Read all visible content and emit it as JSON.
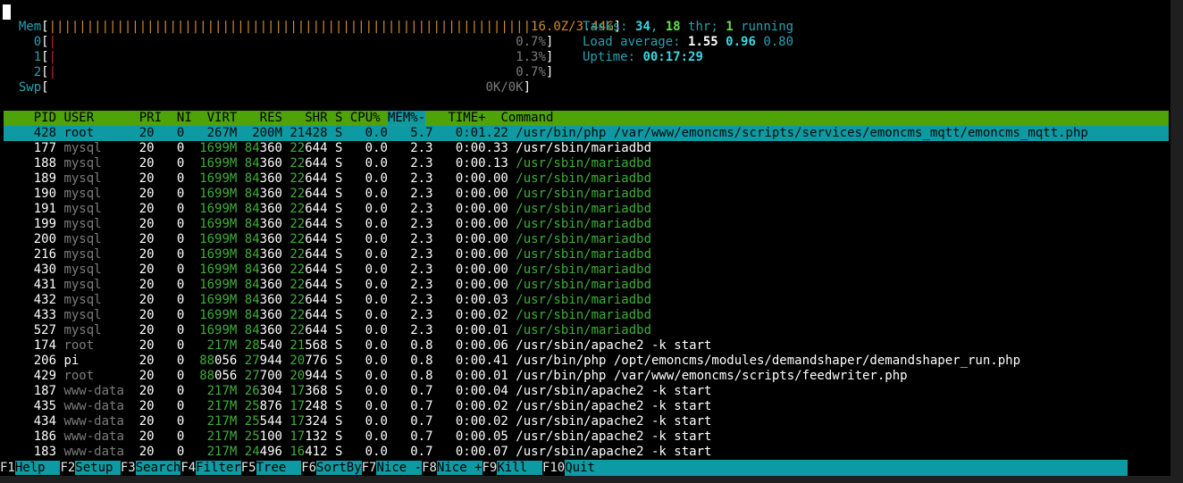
{
  "meters": {
    "mem": {
      "label": "Mem",
      "bar": "||||||||||||||||||||||||||||||||||||||||||||||||||||||||||||||||",
      "value": "16.0Z/3.44G"
    },
    "cpu": [
      {
        "label": "0",
        "value": "0.7%"
      },
      {
        "label": "1",
        "value": "1.3%"
      },
      {
        "label": "2",
        "value": "0.7%"
      }
    ],
    "swp": {
      "label": "Swp",
      "value": "0K/0K"
    }
  },
  "summary": {
    "tasks_label": "Tasks:",
    "tasks": "34",
    "thr": "18",
    "thr_label": "thr;",
    "running": "1",
    "running_label": "running",
    "load_label": "Load average:",
    "load1": "1.55",
    "load5": "0.96",
    "load15": "0.80",
    "uptime_label": "Uptime:",
    "uptime": "00:17:29"
  },
  "header": {
    "pid": "PID",
    "user": "USER",
    "pri": "PRI",
    "ni": "NI",
    "virt": "VIRT",
    "res": "RES",
    "shr": "SHR",
    "s": "S",
    "cpu": "CPU%",
    "mem": "MEM%-",
    "time": "TIME+",
    "command": "Command"
  },
  "rows": [
    {
      "pid": "428",
      "user": "root",
      "pri": "20",
      "ni": "0",
      "virt": "267M",
      "res": "200M",
      "shr": "21428",
      "s": "S",
      "cpu": "0.0",
      "mem": "5.7",
      "time": "0:01.22",
      "cmd": "/usr/bin/php /var/www/emoncms/scripts/services/emoncms_mqtt/emoncms_mqtt.php",
      "selected": true
    },
    {
      "pid": "177",
      "user": "mysql",
      "pri": "20",
      "ni": "0",
      "virt": "1699M",
      "res": "84360",
      "shr": "22644",
      "s": "S",
      "cpu": "0.0",
      "mem": "2.3",
      "time": "0:00.33",
      "cmd": "/usr/sbin/mariadbd"
    },
    {
      "pid": "188",
      "user": "mysql",
      "pri": "20",
      "ni": "0",
      "virt": "1699M",
      "res": "84360",
      "shr": "22644",
      "s": "S",
      "cpu": "0.0",
      "mem": "2.3",
      "time": "0:00.13",
      "cmd": "/usr/sbin/mariadbd",
      "thread": true
    },
    {
      "pid": "189",
      "user": "mysql",
      "pri": "20",
      "ni": "0",
      "virt": "1699M",
      "res": "84360",
      "shr": "22644",
      "s": "S",
      "cpu": "0.0",
      "mem": "2.3",
      "time": "0:00.00",
      "cmd": "/usr/sbin/mariadbd",
      "thread": true
    },
    {
      "pid": "190",
      "user": "mysql",
      "pri": "20",
      "ni": "0",
      "virt": "1699M",
      "res": "84360",
      "shr": "22644",
      "s": "S",
      "cpu": "0.0",
      "mem": "2.3",
      "time": "0:00.00",
      "cmd": "/usr/sbin/mariadbd",
      "thread": true
    },
    {
      "pid": "191",
      "user": "mysql",
      "pri": "20",
      "ni": "0",
      "virt": "1699M",
      "res": "84360",
      "shr": "22644",
      "s": "S",
      "cpu": "0.0",
      "mem": "2.3",
      "time": "0:00.00",
      "cmd": "/usr/sbin/mariadbd",
      "thread": true
    },
    {
      "pid": "199",
      "user": "mysql",
      "pri": "20",
      "ni": "0",
      "virt": "1699M",
      "res": "84360",
      "shr": "22644",
      "s": "S",
      "cpu": "0.0",
      "mem": "2.3",
      "time": "0:00.00",
      "cmd": "/usr/sbin/mariadbd",
      "thread": true
    },
    {
      "pid": "200",
      "user": "mysql",
      "pri": "20",
      "ni": "0",
      "virt": "1699M",
      "res": "84360",
      "shr": "22644",
      "s": "S",
      "cpu": "0.0",
      "mem": "2.3",
      "time": "0:00.00",
      "cmd": "/usr/sbin/mariadbd",
      "thread": true
    },
    {
      "pid": "216",
      "user": "mysql",
      "pri": "20",
      "ni": "0",
      "virt": "1699M",
      "res": "84360",
      "shr": "22644",
      "s": "S",
      "cpu": "0.0",
      "mem": "2.3",
      "time": "0:00.00",
      "cmd": "/usr/sbin/mariadbd",
      "thread": true
    },
    {
      "pid": "430",
      "user": "mysql",
      "pri": "20",
      "ni": "0",
      "virt": "1699M",
      "res": "84360",
      "shr": "22644",
      "s": "S",
      "cpu": "0.0",
      "mem": "2.3",
      "time": "0:00.00",
      "cmd": "/usr/sbin/mariadbd",
      "thread": true
    },
    {
      "pid": "431",
      "user": "mysql",
      "pri": "20",
      "ni": "0",
      "virt": "1699M",
      "res": "84360",
      "shr": "22644",
      "s": "S",
      "cpu": "0.0",
      "mem": "2.3",
      "time": "0:00.00",
      "cmd": "/usr/sbin/mariadbd",
      "thread": true
    },
    {
      "pid": "432",
      "user": "mysql",
      "pri": "20",
      "ni": "0",
      "virt": "1699M",
      "res": "84360",
      "shr": "22644",
      "s": "S",
      "cpu": "0.0",
      "mem": "2.3",
      "time": "0:00.03",
      "cmd": "/usr/sbin/mariadbd",
      "thread": true
    },
    {
      "pid": "433",
      "user": "mysql",
      "pri": "20",
      "ni": "0",
      "virt": "1699M",
      "res": "84360",
      "shr": "22644",
      "s": "S",
      "cpu": "0.0",
      "mem": "2.3",
      "time": "0:00.02",
      "cmd": "/usr/sbin/mariadbd",
      "thread": true
    },
    {
      "pid": "527",
      "user": "mysql",
      "pri": "20",
      "ni": "0",
      "virt": "1699M",
      "res": "84360",
      "shr": "22644",
      "s": "S",
      "cpu": "0.0",
      "mem": "2.3",
      "time": "0:00.01",
      "cmd": "/usr/sbin/mariadbd",
      "thread": true
    },
    {
      "pid": "174",
      "user": "root",
      "pri": "20",
      "ni": "0",
      "virt": "217M",
      "res": "28540",
      "shr": "21568",
      "s": "S",
      "cpu": "0.0",
      "mem": "0.8",
      "time": "0:00.06",
      "cmd": "/usr/sbin/apache2 -k start"
    },
    {
      "pid": "206",
      "user": "pi",
      "pri": "20",
      "ni": "0",
      "virt": "88056",
      "res": "27944",
      "shr": "20776",
      "s": "S",
      "cpu": "0.0",
      "mem": "0.8",
      "time": "0:00.41",
      "cmd": "/usr/bin/php /opt/emoncms/modules/demandshaper/demandshaper_run.php",
      "user_bright": true
    },
    {
      "pid": "429",
      "user": "root",
      "pri": "20",
      "ni": "0",
      "virt": "88056",
      "res": "27700",
      "shr": "20944",
      "s": "S",
      "cpu": "0.0",
      "mem": "0.8",
      "time": "0:00.01",
      "cmd": "/usr/bin/php /var/www/emoncms/scripts/feedwriter.php"
    },
    {
      "pid": "187",
      "user": "www-data",
      "pri": "20",
      "ni": "0",
      "virt": "217M",
      "res": "26304",
      "shr": "17368",
      "s": "S",
      "cpu": "0.0",
      "mem": "0.7",
      "time": "0:00.04",
      "cmd": "/usr/sbin/apache2 -k start"
    },
    {
      "pid": "435",
      "user": "www-data",
      "pri": "20",
      "ni": "0",
      "virt": "217M",
      "res": "25876",
      "shr": "17248",
      "s": "S",
      "cpu": "0.0",
      "mem": "0.7",
      "time": "0:00.02",
      "cmd": "/usr/sbin/apache2 -k start"
    },
    {
      "pid": "434",
      "user": "www-data",
      "pri": "20",
      "ni": "0",
      "virt": "217M",
      "res": "25544",
      "shr": "17324",
      "s": "S",
      "cpu": "0.0",
      "mem": "0.7",
      "time": "0:00.02",
      "cmd": "/usr/sbin/apache2 -k start"
    },
    {
      "pid": "186",
      "user": "www-data",
      "pri": "20",
      "ni": "0",
      "virt": "217M",
      "res": "25100",
      "shr": "17132",
      "s": "S",
      "cpu": "0.0",
      "mem": "0.7",
      "time": "0:00.05",
      "cmd": "/usr/sbin/apache2 -k start"
    },
    {
      "pid": "183",
      "user": "www-data",
      "pri": "20",
      "ni": "0",
      "virt": "217M",
      "res": "24496",
      "shr": "16412",
      "s": "S",
      "cpu": "0.0",
      "mem": "0.7",
      "time": "0:00.07",
      "cmd": "/usr/sbin/apache2 -k start"
    }
  ],
  "fkeys": [
    {
      "key": "F1",
      "label": "Help  "
    },
    {
      "key": "F2",
      "label": "Setup "
    },
    {
      "key": "F3",
      "label": "Search"
    },
    {
      "key": "F4",
      "label": "Filter"
    },
    {
      "key": "F5",
      "label": "Tree  "
    },
    {
      "key": "F6",
      "label": "SortBy"
    },
    {
      "key": "F7",
      "label": "Nice -"
    },
    {
      "key": "F8",
      "label": "Nice +"
    },
    {
      "key": "F9",
      "label": "Kill  "
    },
    {
      "key": "F10",
      "label": "Quit"
    }
  ],
  "colors": {
    "header_bg": "#4ea309",
    "selected_bg": "#0e9aa2",
    "fkey_label_bg": "#0e9aa2"
  }
}
